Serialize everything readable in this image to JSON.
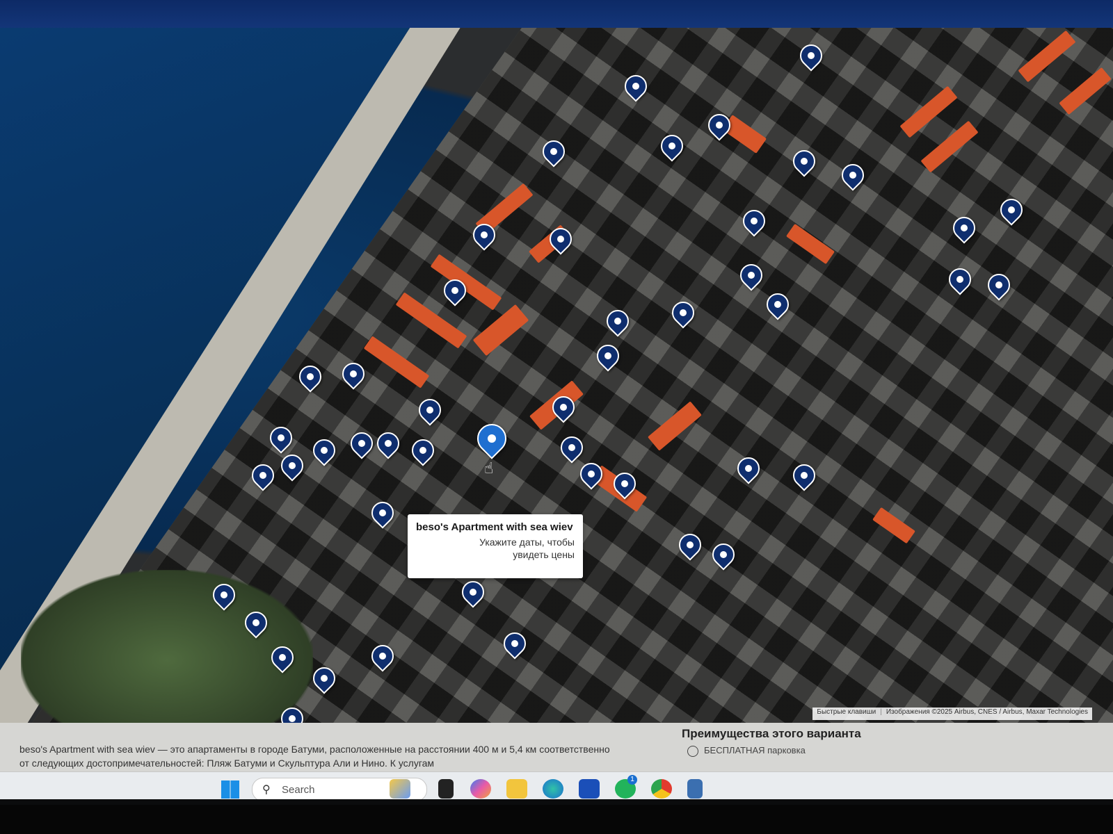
{
  "tooltip": {
    "title": "beso's Apartment with sea wiev",
    "line1": "Укажите даты, чтобы",
    "line2": "увидеть цены"
  },
  "attribution": {
    "shortcuts": "Быстрые клавиши",
    "imagery": "Изображения ©2025 Airbus, CNES / Airbus, Maxar Technologies"
  },
  "description": {
    "text": "beso's Apartment with sea wiev — это апартаменты в городе Батуми, расположенные на расстоянии 400 м и 5,4 км соответственно от следующих достопримечательностей: Пляж Батуми и Скульптура Али и Нино. К услугам"
  },
  "advantages": {
    "title": "Преимущества этого варианта",
    "first_item": "БЕСПЛАТНАЯ парковка"
  },
  "taskbar": {
    "search_placeholder": "Search",
    "whatsapp_badge": "1"
  },
  "colors": {
    "pin": "#0f2e6e",
    "pin_active": "#1f6fd0",
    "roof": "#d8562a",
    "sea": "#083058"
  }
}
